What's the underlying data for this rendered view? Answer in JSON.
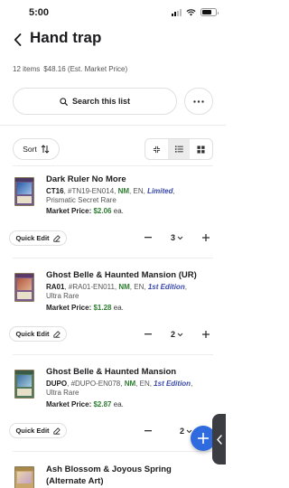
{
  "status_bar": {
    "time": "5:00"
  },
  "header": {
    "title": "Hand trap"
  },
  "summary": {
    "items": "12 items",
    "price": "$48.16 (Est. Market Price)"
  },
  "search": {
    "label": "Search this list"
  },
  "toolbar": {
    "sort_label": "Sort"
  },
  "items": [
    {
      "name": "Dark Ruler No More",
      "set_code": "CT16",
      "number": ", #TN19-EN014, ",
      "condition": "NM",
      "lang": ", EN, ",
      "edition": "Limited",
      "trail": ",",
      "rarity": "Prismatic Secret Rare",
      "price_label": "Market Price:",
      "price": "$2.06",
      "price_unit": "ea.",
      "quick_edit": "Quick Edit",
      "qty": "3"
    },
    {
      "name": "Ghost Belle & Haunted Mansion (UR)",
      "set_code": "RA01",
      "number": ", #RA01-EN011, ",
      "condition": "NM",
      "lang": ", EN, ",
      "edition": "1st Edition",
      "trail": ",",
      "rarity": "Ultra Rare",
      "price_label": "Market Price:",
      "price": "$1.28",
      "price_unit": "ea.",
      "quick_edit": "Quick Edit",
      "qty": "2"
    },
    {
      "name": "Ghost Belle & Haunted Mansion",
      "set_code": "DUPO",
      "number": ", #DUPO-EN078, ",
      "condition": "NM",
      "lang": ", EN, ",
      "edition": "1st Edition",
      "trail": ",",
      "rarity": "Ultra Rare",
      "price_label": "Market Price:",
      "price": "$2.87",
      "price_unit": "ea.",
      "quick_edit": "Quick Edit",
      "qty": "2"
    },
    {
      "name": "Ash Blossom & Joyous Spring",
      "name_line2": "(Alternate Art)"
    }
  ],
  "colors": {
    "accent": "#2f6bdf",
    "condition": "#2e7d32",
    "edition": "#3949ab",
    "price": "#2e7d32"
  }
}
